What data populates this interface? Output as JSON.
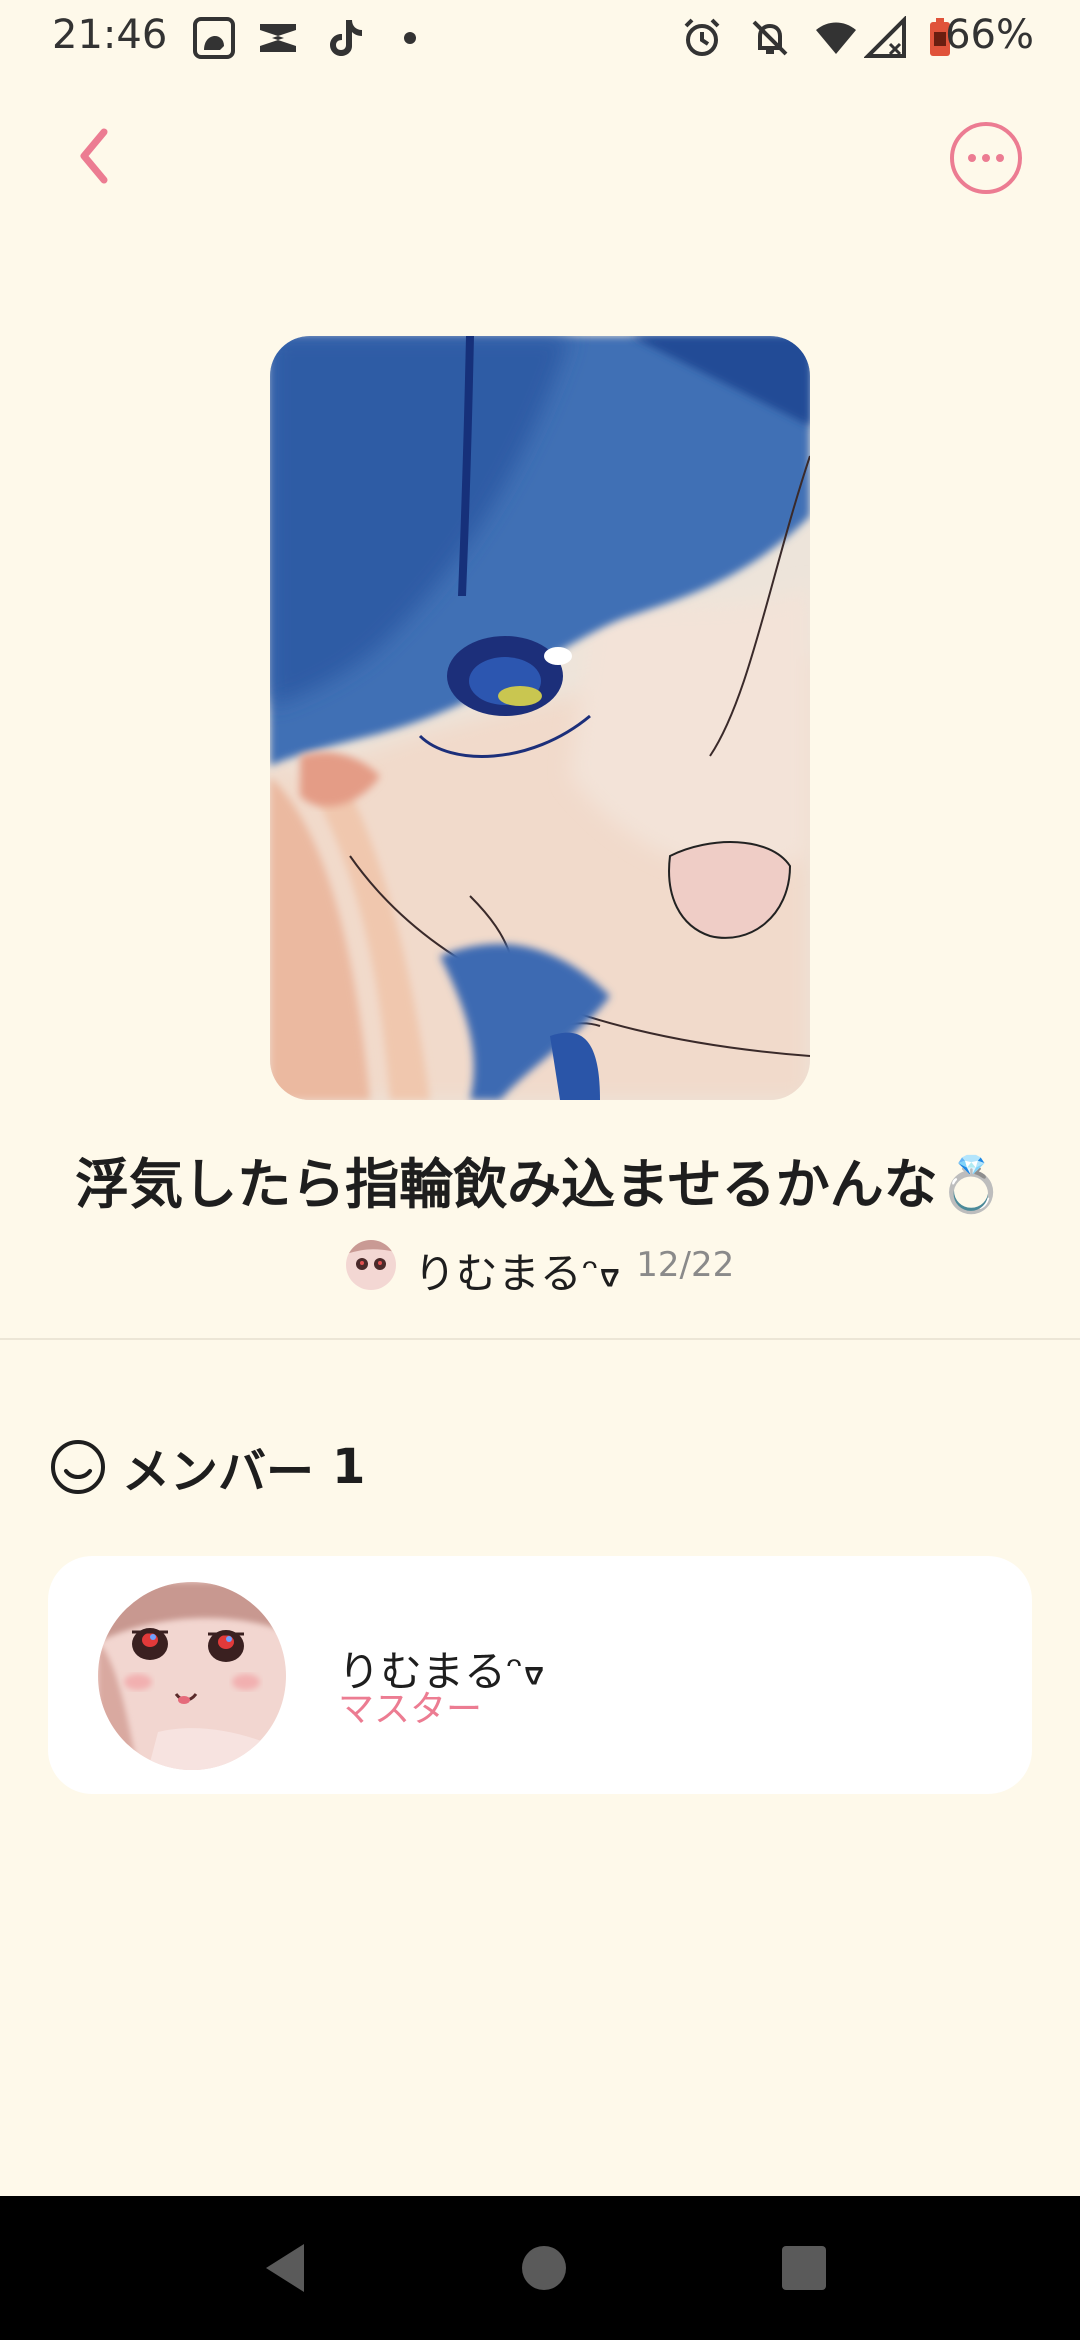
{
  "status_bar": {
    "time": "21:46",
    "battery": "66%",
    "icons": [
      "app-icon",
      "capcut-icon",
      "tiktok-icon",
      "dot-icon",
      "alarm-icon",
      "bell-off-icon",
      "wifi-icon",
      "signal-icon",
      "battery-icon"
    ]
  },
  "header": {
    "back_icon": "chevron-left-icon",
    "more_icon": "more-horizontal-icon"
  },
  "post": {
    "title": "浮気したら指輪飲み込ませるかんな💍",
    "author": "りむまるᵔᢦ",
    "date": "12/22"
  },
  "members": {
    "title": "メンバー",
    "count": "1",
    "items": [
      {
        "name": "りむまるᵔᢦ",
        "role": "マスター"
      }
    ]
  },
  "colors": {
    "background": "#FEF9EA",
    "accent": "#EC7C92",
    "card": "#FFFFFF"
  }
}
